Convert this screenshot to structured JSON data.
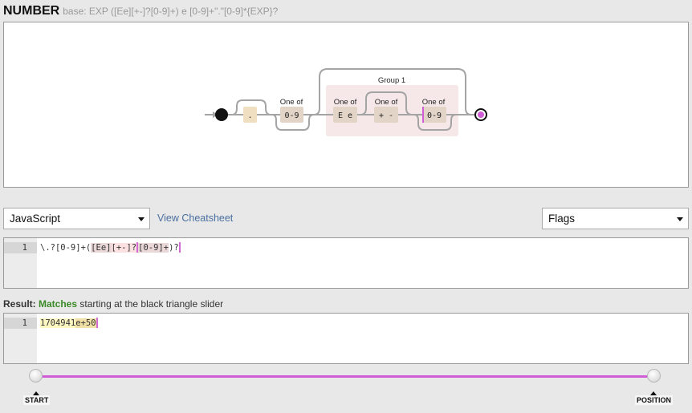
{
  "header": {
    "title": "NUMBER",
    "description": "base: EXP ([Ee][+-]?[0-9]+) e [0-9]+\".\"[0-9]*{EXP}?"
  },
  "diagram": {
    "nodes": [
      {
        "label": "",
        "text": "."
      },
      {
        "label": "One of",
        "text": "0-9"
      },
      {
        "label": "One of",
        "text": "E e"
      },
      {
        "label": "One of",
        "text": "+ -"
      },
      {
        "label": "One of",
        "text": "0-9"
      }
    ],
    "group_label": "Group 1"
  },
  "controls": {
    "flavor": "JavaScript",
    "cheatsheet": "View Cheatsheet",
    "flags": "Flags"
  },
  "regex_editor": {
    "line_number": "1",
    "segments": [
      "\\.?[0-9]+(",
      "[Ee]",
      "[+-]?",
      "[0-9]+",
      ")?"
    ]
  },
  "result": {
    "label": "Result:",
    "status": "Matches",
    "detail": "starting at the black triangle slider"
  },
  "test_editor": {
    "line_number": "1",
    "match_a": "1704941",
    "match_b": "e+50"
  },
  "slider": {
    "start_label": "START",
    "position_label": "POSITION"
  }
}
